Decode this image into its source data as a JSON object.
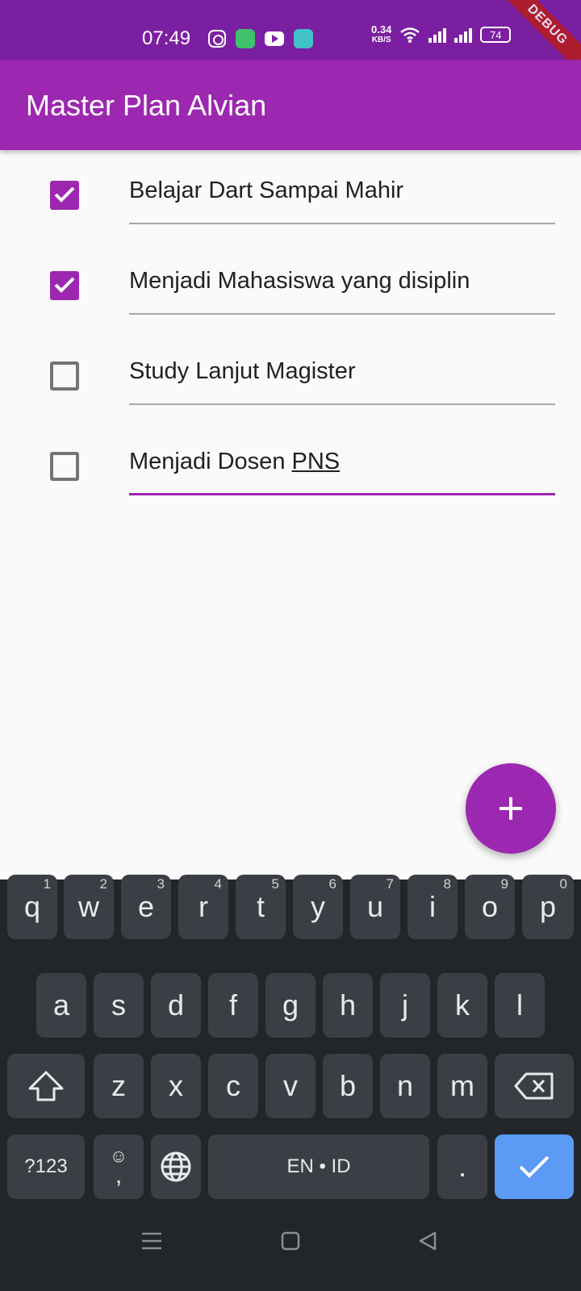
{
  "status_bar": {
    "time": "07:49",
    "net_speed_value": "0.34",
    "net_speed_unit": "KB/S",
    "battery": "74",
    "debug_banner": "DEBUG"
  },
  "app_bar": {
    "title": "Master Plan Alvian"
  },
  "tasks": [
    {
      "text": "Belajar Dart Sampai Mahir",
      "done": true
    },
    {
      "text": "Menjadi Mahasiswa yang disiplin",
      "done": true
    },
    {
      "text": "Study Lanjut Magister",
      "done": false
    },
    {
      "text_prefix": "Menjadi Dosen ",
      "text_underlined": "PNS",
      "done": false
    }
  ],
  "fab": {
    "icon": "plus-icon"
  },
  "keyboard": {
    "row1": [
      {
        "label": "q",
        "hint": "1"
      },
      {
        "label": "w",
        "hint": "2"
      },
      {
        "label": "e",
        "hint": "3"
      },
      {
        "label": "r",
        "hint": "4"
      },
      {
        "label": "t",
        "hint": "5"
      },
      {
        "label": "y",
        "hint": "6"
      },
      {
        "label": "u",
        "hint": "7"
      },
      {
        "label": "i",
        "hint": "8"
      },
      {
        "label": "o",
        "hint": "9"
      },
      {
        "label": "p",
        "hint": "0"
      }
    ],
    "row2": [
      "a",
      "s",
      "d",
      "f",
      "g",
      "h",
      "j",
      "k",
      "l"
    ],
    "row3": [
      "z",
      "x",
      "c",
      "v",
      "b",
      "n",
      "m"
    ],
    "symbols_label": "?123",
    "comma_label": ",",
    "space_label": "EN • ID",
    "period_label": ".",
    "accent_color": "#5b9bf5"
  },
  "colors": {
    "primary": "#9c27b0",
    "status_bar": "#7b1fa2"
  }
}
